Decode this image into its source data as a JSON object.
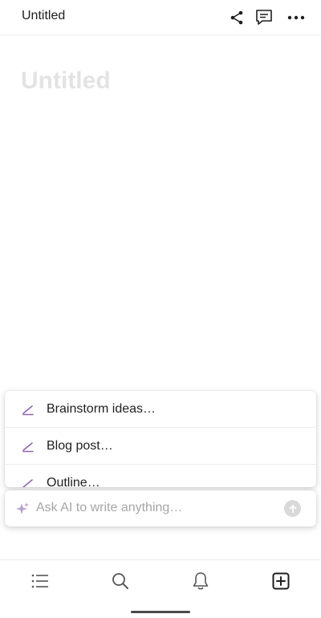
{
  "header": {
    "title": "Untitled",
    "share_icon": "share-icon",
    "comment_icon": "comment-icon",
    "more_icon": "more-icon"
  },
  "page": {
    "title_placeholder": "Untitled"
  },
  "ai_menu": {
    "items": [
      {
        "label": "Brainstorm ideas…",
        "icon": "pen-icon"
      },
      {
        "label": "Blog post…",
        "icon": "pen-icon"
      },
      {
        "label": "Outline…",
        "icon": "pen-icon"
      }
    ]
  },
  "ai_input": {
    "placeholder": "Ask AI to write anything…",
    "icon": "sparkle-icon",
    "send_icon": "send-arrow-icon"
  },
  "bottom_nav": {
    "items": [
      "list-icon",
      "search-icon",
      "bell-icon",
      "new-page-icon"
    ]
  },
  "colors": {
    "accent_purple": "#9065b0",
    "title_placeholder": "#e3e3e3",
    "input_placeholder": "#a6a6a6"
  }
}
